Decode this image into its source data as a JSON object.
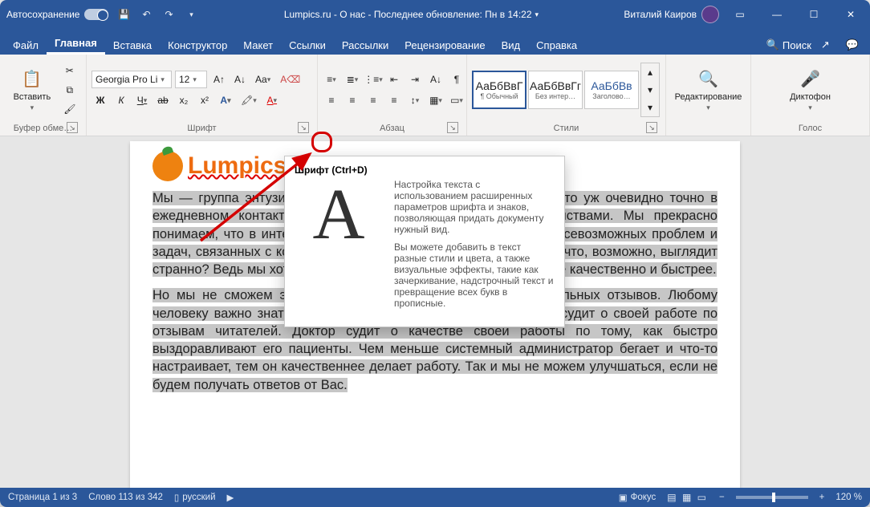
{
  "titlebar": {
    "autosave": "Автосохранение",
    "doc_title": "Lumpics.ru - О нас - Последнее обновление: Пн в 14:22",
    "user": "Виталий Каиров"
  },
  "tabs": {
    "file": "Файл",
    "home": "Главная",
    "insert": "Вставка",
    "design": "Конструктор",
    "layout": "Макет",
    "references": "Ссылки",
    "mailings": "Рассылки",
    "review": "Рецензирование",
    "view": "Вид",
    "help": "Справка",
    "search": "Поиск"
  },
  "ribbon": {
    "clipboard": {
      "label": "Буфер обме…",
      "paste": "Вставить"
    },
    "font": {
      "label": "Шрифт",
      "name": "Georgia Pro Li",
      "size": "12",
      "buttons": {
        "bold": "Ж",
        "italic": "К",
        "underline": "Ч",
        "strike": "ab",
        "sub": "x₂",
        "sup": "x²",
        "effects": "A",
        "grow": "A↑",
        "shrink": "A↓",
        "case": "Aa",
        "clear": "A⌫"
      }
    },
    "paragraph": {
      "label": "Абзац"
    },
    "styles": {
      "label": "Стили",
      "items": [
        {
          "preview": "АаБбВвГ",
          "name": "¶ Обычный"
        },
        {
          "preview": "АаБбВвГг",
          "name": "Без интер…"
        },
        {
          "preview": "АаБбВв",
          "name": "Заголово…"
        }
      ]
    },
    "editing": {
      "label": "Редактирование"
    },
    "voice": {
      "label": "Голос",
      "dictate": "Диктофон"
    }
  },
  "tooltip": {
    "title": "Шрифт (Ctrl+D)",
    "p1": "Настройка текста с использованием расширенных параметров шрифта и знаков, позволяющая придать документу нужный вид.",
    "p2": "Вы можете добавить в текст разные стили и цвета, а также визуальные эффекты, такие как зачеркивание, надстрочный текст и превращение всех букв в прописные."
  },
  "document": {
    "brand": "Lumpics.ru",
    "para1": "Мы — группа энтузиастов, находящихся если не в ежечасном, то уж очевидно точно в ежедневном контакте с компьютерами и мобильными устройствами. Мы прекрасно понимаем, что в интернете уже полно информации о решении всевозможных проблем и задач, связанных с компьютерами. Но это не останавливает нас, что, возможно, выглядит странно? Ведь мы хотим решать многие проблемы и задачи более качественно и быстрее.",
    "para2": "Но мы не сможем это делать, если не будем получать правильных отзывов. Любому человеку важно знать, что его действия правильные. Писатель судит о своей работе по отзывам читателей. Доктор судит о качестве своей работы по тому, как быстро выздоравливают его пациенты. Чем меньше системный администратор бегает и что-то настраивает, тем он качественнее делает работу. Так и мы не можем улучшаться, если не будем получать ответов от Вас."
  },
  "status": {
    "page": "Страница 1 из 3",
    "words": "Слово 113 из 342",
    "lang": "русский",
    "focus": "Фокус",
    "zoom": "120 %"
  }
}
